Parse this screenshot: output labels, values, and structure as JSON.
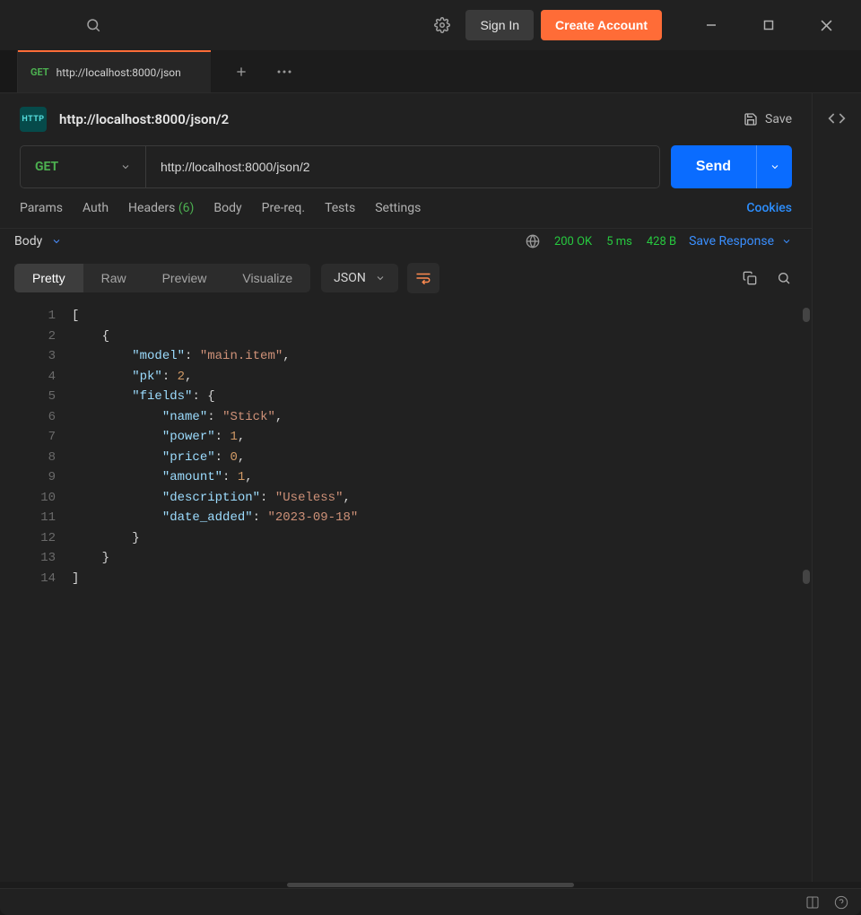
{
  "titlebar": {
    "signin": "Sign In",
    "create": "Create Account"
  },
  "tab": {
    "method": "GET",
    "title": "http://localhost:8000/json"
  },
  "request": {
    "title": "http://localhost:8000/json/2",
    "save": "Save",
    "method": "GET",
    "url": "http://localhost:8000/json/2",
    "send": "Send"
  },
  "req_tabs": {
    "params": "Params",
    "auth": "Auth",
    "headers": "Headers",
    "headers_count": "(6)",
    "body": "Body",
    "prereq": "Pre-req.",
    "tests": "Tests",
    "settings": "Settings",
    "cookies": "Cookies"
  },
  "response": {
    "body": "Body",
    "status": "200 OK",
    "time": "5 ms",
    "size": "428 B",
    "save_response": "Save Response"
  },
  "view_tabs": {
    "pretty": "Pretty",
    "raw": "Raw",
    "preview": "Preview",
    "visualize": "Visualize",
    "format": "JSON"
  },
  "code_lines": [
    "[",
    "    {",
    "        \"model\": \"main.item\",",
    "        \"pk\": 2,",
    "        \"fields\": {",
    "            \"name\": \"Stick\",",
    "            \"power\": 1,",
    "            \"price\": 0,",
    "            \"amount\": 1,",
    "            \"description\": \"Useless\",",
    "            \"date_added\": \"2023-09-18\"",
    "        }",
    "    }",
    "]"
  ],
  "json_payload": [
    {
      "model": "main.item",
      "pk": 2,
      "fields": {
        "name": "Stick",
        "power": 1,
        "price": 0,
        "amount": 1,
        "description": "Useless",
        "date_added": "2023-09-18"
      }
    }
  ]
}
